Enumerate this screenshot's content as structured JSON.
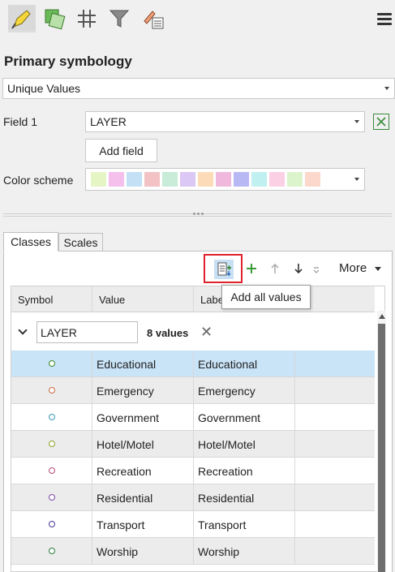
{
  "toolbar": {
    "tools": [
      {
        "name": "primary-symbology-tool",
        "icon": "paintbrush-icon",
        "active": true
      },
      {
        "name": "vary-symbology-tool",
        "icon": "vary-symbology-icon",
        "active": false
      },
      {
        "name": "symbol-layer-drawing-tool",
        "icon": "grid-hash-icon",
        "active": false
      },
      {
        "name": "advanced-symbology-tool",
        "icon": "funnel-icon",
        "active": false
      },
      {
        "name": "label-classes-tool",
        "icon": "brush-list-icon",
        "active": false
      }
    ],
    "menu_icon": "hamburger-icon"
  },
  "symbology": {
    "title": "Primary symbology",
    "method": "Unique Values",
    "field_label": "Field 1",
    "field_value": "LAYER",
    "add_field_label": "Add field",
    "color_scheme_label": "Color scheme",
    "color_scheme": [
      "#e6f5c4",
      "#f5c0ec",
      "#c4e0f4",
      "#f2c2c4",
      "#c8ecd8",
      "#dcc8f4",
      "#fcdcb8",
      "#f0b8dc",
      "#b8b8f4",
      "#c0f0f0",
      "#fcd0e4",
      "#dcf4cc",
      "#fcd8cc"
    ]
  },
  "tabs": [
    {
      "label": "Classes",
      "active": true
    },
    {
      "label": "Scales",
      "active": false
    }
  ],
  "classes_toolbar": {
    "add_all_values": "add-all-values-icon",
    "add": "plus-icon",
    "move_up": "arrow-up-icon",
    "move_down": "arrow-down-icon",
    "more_label": "More",
    "tooltip": "Add all values"
  },
  "table": {
    "headers": [
      "Symbol",
      "Value",
      "Label"
    ],
    "group": {
      "field": "LAYER",
      "count_text": "8 values"
    },
    "rows": [
      {
        "value": "Educational",
        "label": "Educational",
        "color": "#3a8a2a"
      },
      {
        "value": "Emergency",
        "label": "Emergency",
        "color": "#c86a3c"
      },
      {
        "value": "Government",
        "label": "Government",
        "color": "#3a9ab8"
      },
      {
        "value": "Hotel/Motel",
        "label": "Hotel/Motel",
        "color": "#8aa028"
      },
      {
        "value": "Recreation",
        "label": "Recreation",
        "color": "#b84878"
      },
      {
        "value": "Residential",
        "label": "Residential",
        "color": "#7a48a8"
      },
      {
        "value": "Transport",
        "label": "Transport",
        "color": "#4a3a9a"
      },
      {
        "value": "Worship",
        "label": "Worship",
        "color": "#2a7a3a"
      }
    ]
  }
}
